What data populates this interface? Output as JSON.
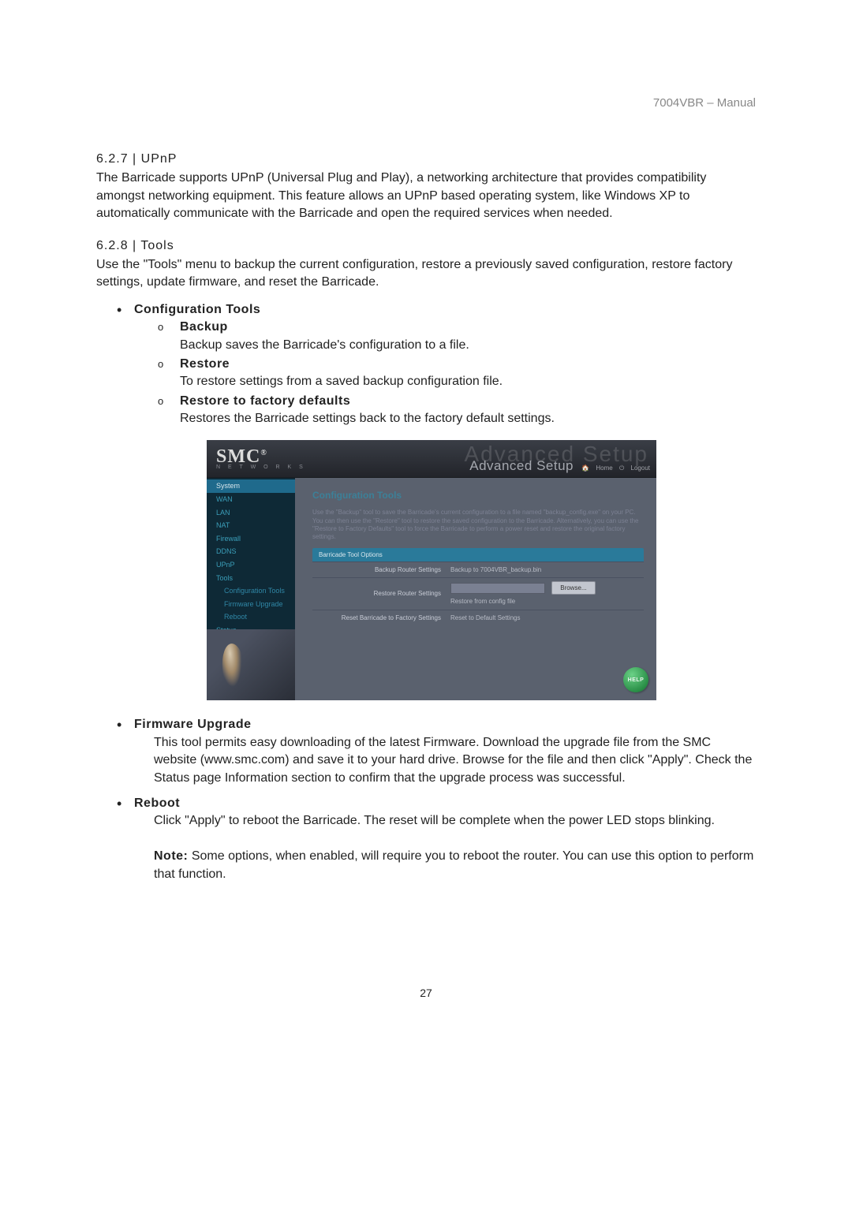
{
  "header": "7004VBR – Manual",
  "section_627": {
    "num": "6.2.7 |  UPnP",
    "body": "The Barricade supports UPnP (Universal Plug and Play), a networking architecture that provides compatibility amongst networking equipment. This feature allows an UPnP based operating system, like Windows XP to automatically communicate with the Barricade and open the required services when needed."
  },
  "section_628": {
    "num": "6.2.8 |  Tools",
    "body": "Use the \"Tools\" menu to backup the current configuration, restore a previously saved configuration, restore factory settings, update firmware, and reset the Barricade."
  },
  "config_tools": {
    "title": "Configuration Tools",
    "backup": {
      "t": "Backup",
      "d": "Backup saves the Barricade's configuration to a file."
    },
    "restore": {
      "t": "Restore",
      "d": "To restore settings from a saved backup configuration file."
    },
    "factory": {
      "t": "Restore to factory defaults",
      "d": "Restores the Barricade settings back to the factory default settings."
    }
  },
  "shot": {
    "logo": "SMC",
    "logo_sub": "N E T W O R K S",
    "banner_ghost": "Advanced Setup",
    "banner": "Advanced Setup",
    "home": "Home",
    "logout": "Logout",
    "sidebar": {
      "system": "System",
      "wan": "WAN",
      "lan": "LAN",
      "nat": "NAT",
      "firewall": "Firewall",
      "ddns": "DDNS",
      "upnp": "UPnP",
      "tools": "Tools",
      "config_tools": "Configuration Tools",
      "firmware": "Firmware Upgrade",
      "reboot": "Reboot",
      "status": "Status"
    },
    "main": {
      "title": "Configuration Tools",
      "desc": "Use the \"Backup\" tool to save the Barricade's current configuration to a file named \"backup_config.exe\" on your PC. You can then use the \"Restore\" tool to restore the saved configuration to the Barricade. Alternatively, you can use the \"Restore to Factory Defaults\" tool to force the Barricade to perform a power reset and restore the original factory settings.",
      "table_header": "Barricade Tool Options",
      "r1_label": "Backup Router Settings",
      "r1_val": "Backup to 7004VBR_backup.bin",
      "r2_label": "Restore Router Settings",
      "r2_browse": "Browse...",
      "r2_val": "Restore from config file",
      "r3_label": "Reset Barricade to Factory Settings",
      "r3_val": "Reset to Default Settings",
      "help": "HELP"
    }
  },
  "firmware": {
    "t": "Firmware Upgrade",
    "d": "This tool permits easy downloading of the latest Firmware. Download the upgrade file from the SMC website (www.smc.com) and save it to your hard drive. Browse for the file and then click \"Apply\". Check the Status page Information section to confirm that the upgrade process was successful."
  },
  "reboot": {
    "t": "Reboot",
    "d": "Click \"Apply\" to reboot the Barricade. The reset will be complete when the power LED stops blinking."
  },
  "note": {
    "label": "Note:",
    "body": " Some options, when enabled, will require you to reboot the router.  You can use this option to perform that function."
  },
  "page_num": "27"
}
